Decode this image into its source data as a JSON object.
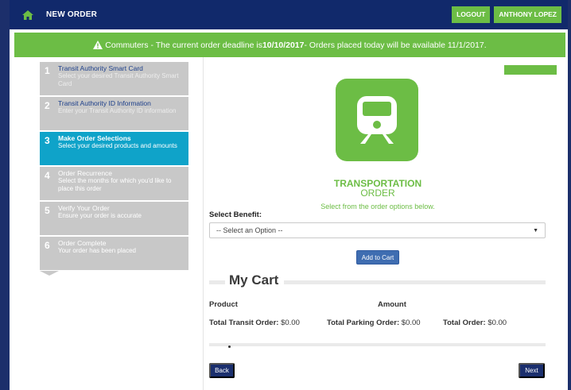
{
  "nav": {
    "home_icon": "home-icon",
    "title": "NEW ORDER",
    "logout_label": "LOGOUT",
    "user_label": "ANTHONY LOPEZ"
  },
  "banner": {
    "icon": "warning-icon",
    "prefix": "Commuters - The current order deadline is ",
    "deadline": "10/10/2017",
    "suffix": " - Orders placed today will be available 11/1/2017."
  },
  "steps": [
    {
      "num": "1",
      "title": "Transit Authority Smart Card",
      "desc": "Select your desired Transit Authority Smart Card",
      "active": false
    },
    {
      "num": "2",
      "title": "Transit Authority ID Information",
      "desc": "Enter your Transit Authority ID information",
      "active": false
    },
    {
      "num": "3",
      "title": "Make Order Selections",
      "desc": "Select your desired products and amounts",
      "active": true
    },
    {
      "num": "4",
      "title": "Order Recurrence",
      "desc": "Select the months for which you'd like to place this order",
      "active": false
    },
    {
      "num": "5",
      "title": "Verify Your Order",
      "desc": "Ensure your order is accurate",
      "active": false
    },
    {
      "num": "6",
      "title": "Order Complete",
      "desc": "Your order has been placed",
      "active": false
    }
  ],
  "main": {
    "service_icon": "train-icon",
    "heading_top": "TRANSPORTATION",
    "heading_bottom": "ORDER",
    "note": "Select from the order options below.",
    "select_label": "Select Benefit:",
    "select_value": "-- Select an Option --",
    "add_to_cart_label": "Add to Cart"
  },
  "cart": {
    "title": "My Cart",
    "col_product": "Product",
    "col_amount": "Amount",
    "transit_label": "Total Transit Order:",
    "transit_value": "$0.00",
    "parking_label": "Total Parking Order:",
    "parking_value": "$0.00",
    "order_label": "Total Order:",
    "order_value": "$0.00"
  },
  "footer": {
    "back_label": "Back",
    "next_label": "Next"
  },
  "colors": {
    "navy": "#11296b",
    "green": "#6cbd45",
    "active_step": "#0fa3c9",
    "step_gray": "#c8c8c8",
    "button_blue": "#3f6db1"
  }
}
